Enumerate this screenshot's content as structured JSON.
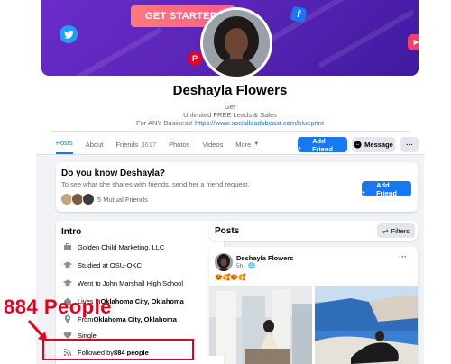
{
  "cover": {
    "cta_label": "GET STARTED!"
  },
  "profile": {
    "name": "Deshayla Flowers",
    "bio_line1": "Get",
    "bio_line2": "Unlimited FREE Leads & Sales",
    "bio_line3_prefix": "For ANY Business!",
    "bio_link": "https://www.socialleadsbeast.com/blueprint"
  },
  "tabs": [
    {
      "label": "Posts"
    },
    {
      "label": "About"
    },
    {
      "label": "Friends",
      "count": "3617"
    },
    {
      "label": "Photos"
    },
    {
      "label": "Videos"
    },
    {
      "label": "More"
    }
  ],
  "actions": {
    "add_friend": "Add Friend",
    "message": "Message",
    "more": "···"
  },
  "suggest": {
    "title": "Do you know Deshayla?",
    "subtitle": "To see what she shares with friends, send her a friend request.",
    "mutual": "5 Mutual Friends",
    "add_friend": "Add Friend"
  },
  "intro": {
    "title": "Intro",
    "items": [
      {
        "icon": "briefcase-icon",
        "text": "Golden Child Marketing, LLC"
      },
      {
        "icon": "graduation-cap-icon",
        "text": "Studied at OSU-OKC"
      },
      {
        "icon": "graduation-cap-icon",
        "text": "Went to John Marshall High School"
      },
      {
        "icon": "home-icon",
        "text_prefix": "Lives in ",
        "text": "Oklahoma City, Oklahoma"
      },
      {
        "icon": "location-pin-icon",
        "text_prefix": "From ",
        "text": "Oklahoma City, Oklahoma"
      },
      {
        "icon": "heart-icon",
        "text": "Single"
      },
      {
        "icon": "rss-icon",
        "text_prefix": "Followed by ",
        "text": "884 people"
      }
    ]
  },
  "posts": {
    "title": "Posts",
    "filters": "Filters",
    "author": "Deshayla Flowers",
    "time": "5h",
    "emojis": "😍🥰😍🥰",
    "more": "···"
  },
  "annotation": {
    "label": "884 People"
  },
  "colors": {
    "facebook_blue": "#1877f2",
    "annotation_red": "#e4001b",
    "cover_purple": "#5a25b8"
  }
}
